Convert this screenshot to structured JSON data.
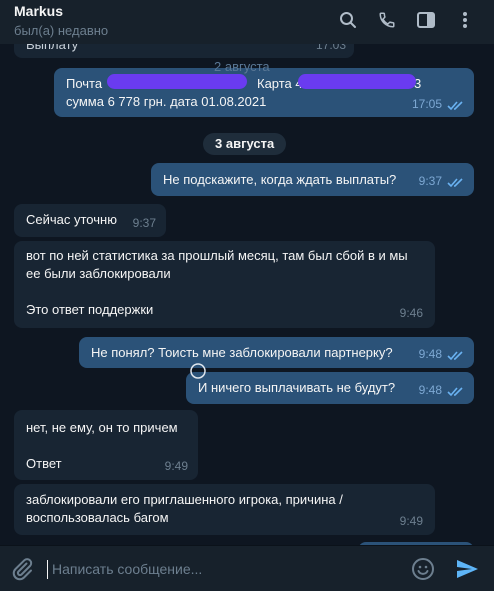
{
  "header": {
    "name": "Markus",
    "status": "был(а) недавно"
  },
  "icons": {
    "search": "search-icon",
    "call": "phone-icon",
    "sidebar": "sidebar-toggle-icon",
    "menu": "more-vertical-icon",
    "attach": "paperclip-icon",
    "emoji": "emoji-icon",
    "send": "send-icon"
  },
  "colors": {
    "background": "#0e1621",
    "incoming_bubble": "#182533",
    "outgoing_bubble": "#2b5278",
    "read_ticks": "#6ab2f2",
    "redaction": "#6a3bf0"
  },
  "messages": {
    "m0": {
      "text": "Выплату",
      "time": "17:03"
    },
    "m1": {
      "part1": "Почта",
      "part2": "Карта 4",
      "part3": "3",
      "line2": "сумма 6 778 грн. дата 01.08.2021",
      "time": "17:05",
      "ghost_date": "2 августа"
    },
    "date_sep": "3 августа",
    "m2": {
      "text": "Не подскажите, когда ждать выплаты?",
      "time": "9:37"
    },
    "m3": {
      "text": "Сейчас уточню",
      "time": "9:37"
    },
    "m4": {
      "text": "вот по ней статистика за прошлый месяц, там был сбой в и мы\nее были заблокировали\n\nЭто ответ поддержки",
      "time": "9:46"
    },
    "m5": {
      "text": "Не понял? Тоисть мне заблокировали партнерку?",
      "time": "9:48"
    },
    "m6": {
      "text": "И ничего выплачивать не будут?",
      "time": "9:48"
    },
    "m7": {
      "text": "нет, не ему, он то причем\n\nОтвет",
      "time": "9:49"
    },
    "m8": {
      "text": "заблокировали его приглашенного игрока, причина /\nвоспользовалась багом",
      "time": "9:49"
    }
  },
  "composer": {
    "placeholder": "Написать сообщение..."
  }
}
